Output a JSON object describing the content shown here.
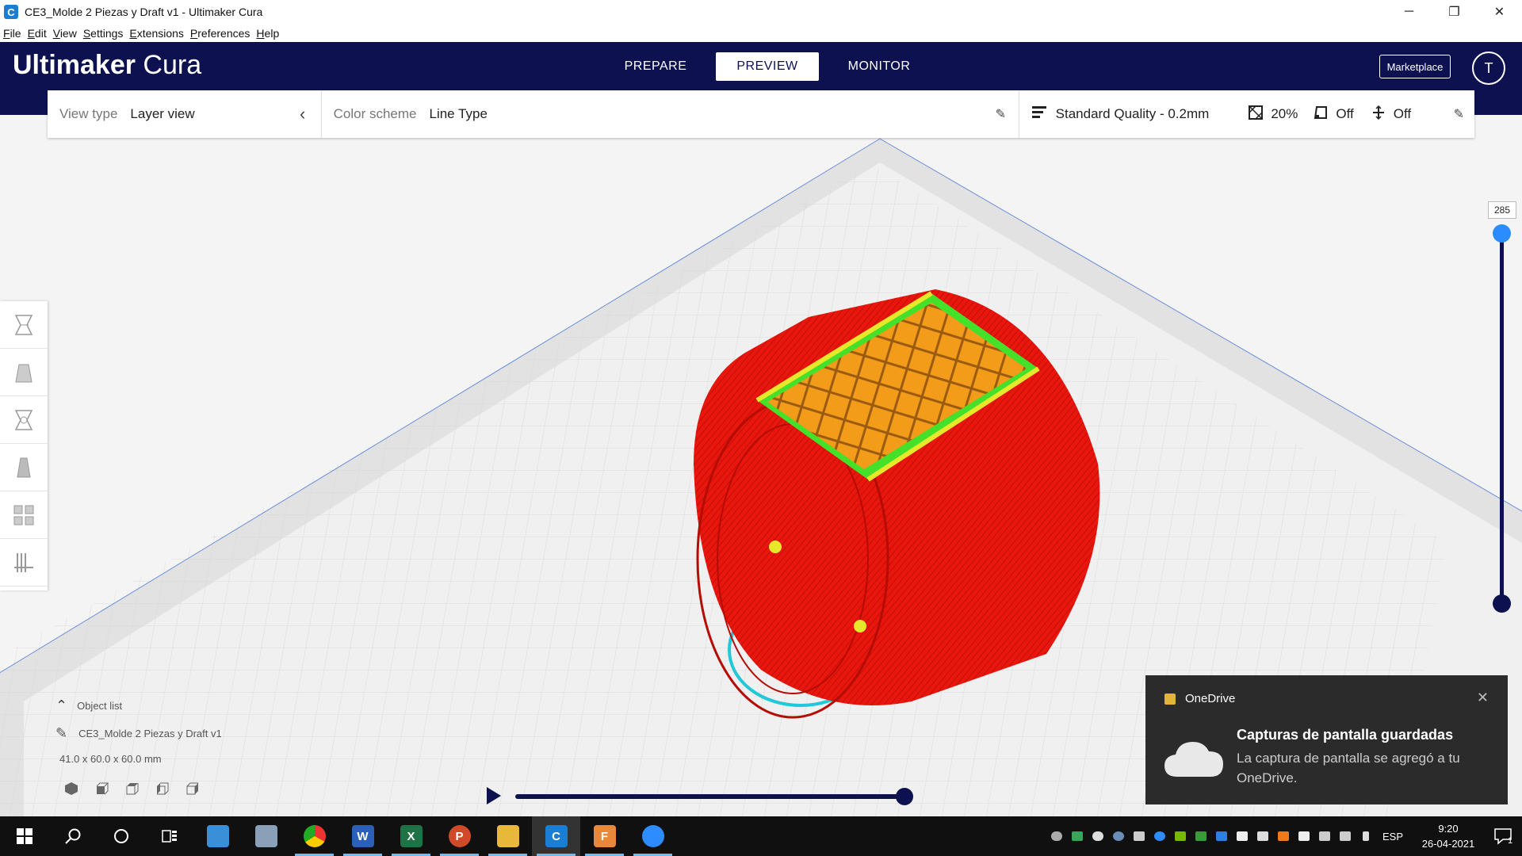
{
  "window": {
    "title": "CE3_Molde 2 Piezas y Draft v1 - Ultimaker Cura",
    "app_icon_letter": "C",
    "minimize": "─",
    "restore": "❐",
    "close": "✕"
  },
  "menu": [
    "File",
    "Edit",
    "View",
    "Settings",
    "Extensions",
    "Preferences",
    "Help"
  ],
  "header": {
    "brand_bold": "Ultimaker",
    "brand_light": "Cura",
    "stages": [
      "PREPARE",
      "PREVIEW",
      "MONITOR"
    ],
    "active_stage": "PREVIEW",
    "marketplace": "Marketplace",
    "avatar_initial": "T"
  },
  "settings_bar": {
    "view_type_label": "View type",
    "view_type_value": "Layer view",
    "color_scheme_label": "Color scheme",
    "color_scheme_value": "Line Type",
    "quality": "Standard Quality - 0.2mm",
    "infill": "20%",
    "support": "Off",
    "adhesion": "Off"
  },
  "layer_slider": {
    "current_layer": "285"
  },
  "object_list": {
    "title": "Object list",
    "object_name": "CE3_Molde 2 Piezas y Draft v1",
    "dimensions": "41.0 x 60.0 x 60.0 mm"
  },
  "timeline": {
    "progress": 1.0
  },
  "toast": {
    "app_name": "OneDrive",
    "headline": "Capturas de pantalla guardadas",
    "body": "La captura de pantalla se agregó a tu OneDrive.",
    "close": "✕"
  },
  "taskbar": {
    "language": "ESP",
    "time": "9:20",
    "date": "26-04-2021",
    "notification_count": "1"
  },
  "colors": {
    "header_bg": "#0d1150",
    "accent_blue": "#2a8cff",
    "print_red": "#e8160c",
    "infill_orange": "#f39c1a",
    "skin_yellow": "#e8e82a",
    "wall_green": "#44e02a",
    "skirt_cyan": "#20c8d8"
  }
}
